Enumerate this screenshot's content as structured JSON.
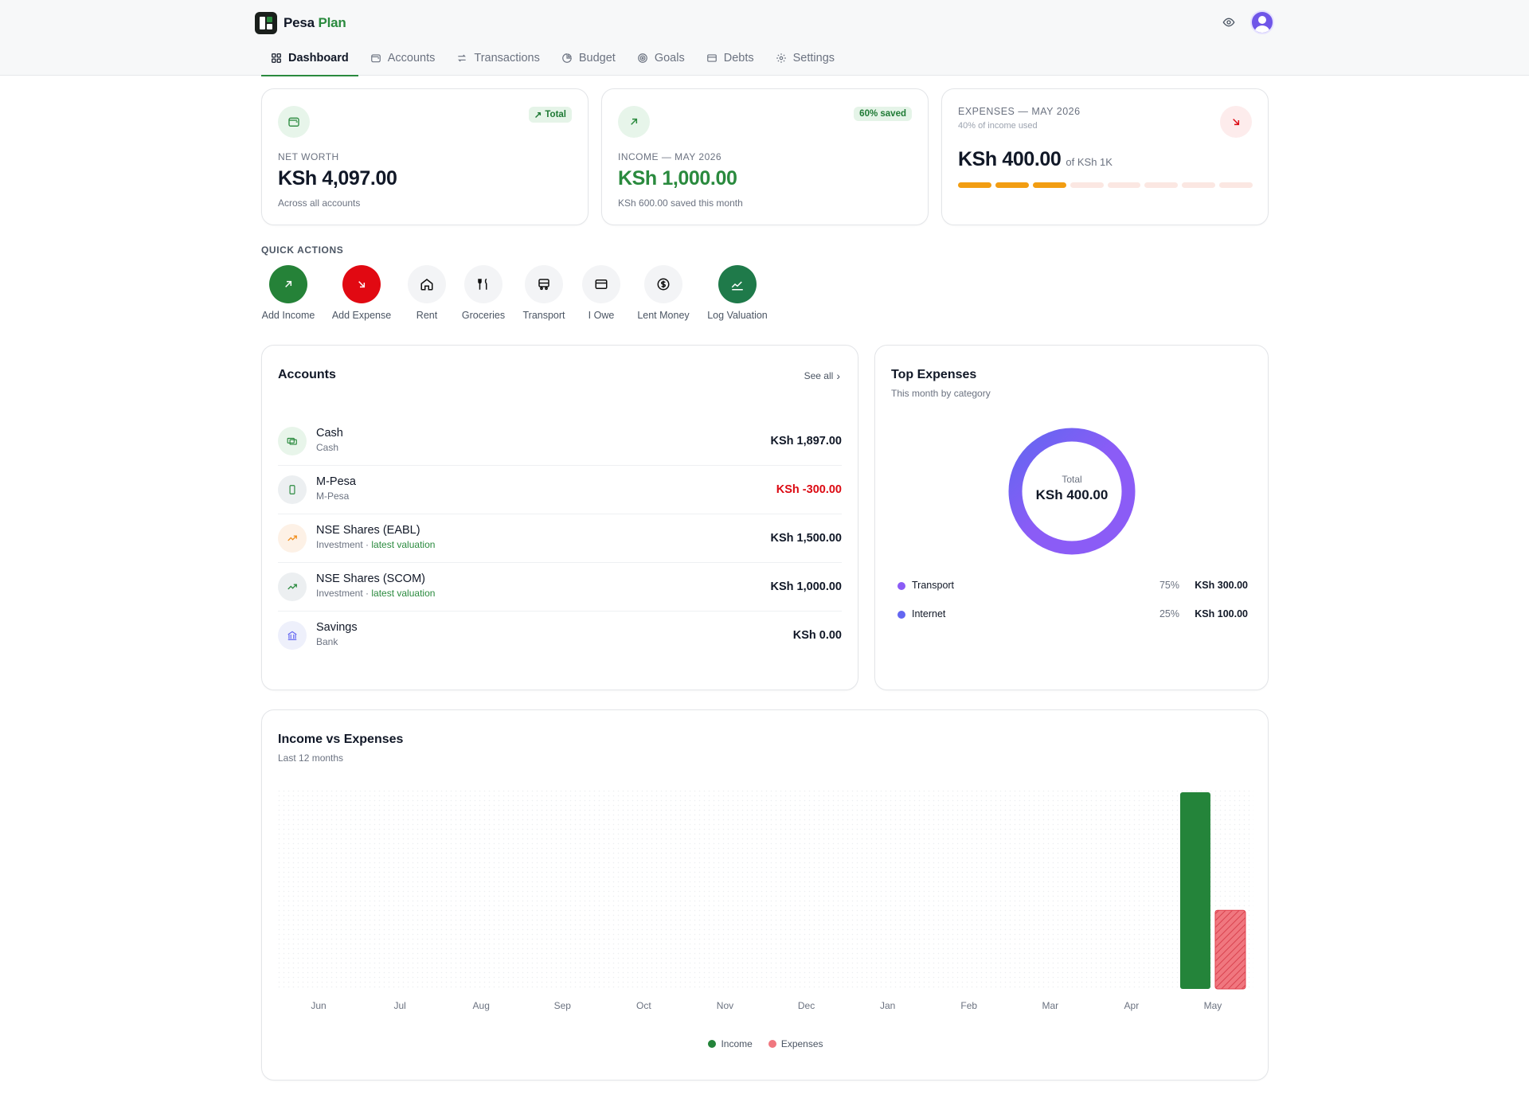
{
  "app": {
    "name_part1": "Pesa",
    "name_part2": "Plan"
  },
  "header": {
    "eye_icon": "eye-icon",
    "avatar_icon": "user-icon"
  },
  "nav": {
    "tabs": [
      {
        "label": "Dashboard",
        "icon": "grid-icon",
        "active": true
      },
      {
        "label": "Accounts",
        "icon": "wallet-icon"
      },
      {
        "label": "Transactions",
        "icon": "arrows-icon"
      },
      {
        "label": "Budget",
        "icon": "pie-icon"
      },
      {
        "label": "Goals",
        "icon": "target-icon"
      },
      {
        "label": "Debts",
        "icon": "card-icon"
      },
      {
        "label": "Settings",
        "icon": "gear-icon"
      }
    ]
  },
  "net_worth": {
    "tag": "Total",
    "label": "NET WORTH",
    "value": "KSh 4,097.00",
    "sub": "Across all accounts"
  },
  "income": {
    "tag": "60% saved",
    "label": "INCOME — MAY 2026",
    "value": "KSh 1,000.00",
    "sub": "KSh 600.00 saved this month"
  },
  "expenses": {
    "label": "EXPENSES — MAY 2026",
    "sub": "40% of income used",
    "value": "KSh 400.00",
    "of": "of KSh 1K",
    "progress_fraction": 0.4,
    "segments": 8
  },
  "quick_actions": {
    "title": "QUICK ACTIONS",
    "items": [
      {
        "label": "Add Income",
        "icon": "arrow-up-right-icon"
      },
      {
        "label": "Add Expense",
        "icon": "arrow-down-right-icon"
      },
      {
        "label": "Rent",
        "icon": "home-icon"
      },
      {
        "label": "Groceries",
        "icon": "utensils-icon"
      },
      {
        "label": "Transport",
        "icon": "bus-icon"
      },
      {
        "label": "I Owe",
        "icon": "card-icon"
      },
      {
        "label": "Lent Money",
        "icon": "dollar-icon"
      },
      {
        "label": "Log Valuation",
        "icon": "chart-line-icon"
      }
    ]
  },
  "accounts": {
    "title": "Accounts",
    "see_all": "See all",
    "rows": [
      {
        "name": "Cash",
        "type": "Cash",
        "note": "",
        "balance": "KSh 1,897.00",
        "negative": false,
        "icon": "cash-icon"
      },
      {
        "name": "M-Pesa",
        "type": "M-Pesa",
        "note": "",
        "balance": "KSh -300.00",
        "negative": true,
        "icon": "phone-icon"
      },
      {
        "name": "NSE Shares (EABL)",
        "type": "Investment · ",
        "note": "latest valuation",
        "balance": "KSh 1,500.00",
        "negative": false,
        "icon": "trend-up-icon"
      },
      {
        "name": "NSE Shares (SCOM)",
        "type": "Investment · ",
        "note": "latest valuation",
        "balance": "KSh 1,000.00",
        "negative": false,
        "icon": "trend-up-icon"
      },
      {
        "name": "Savings",
        "type": "Bank",
        "note": "",
        "balance": "KSh 0.00",
        "negative": false,
        "icon": "bank-icon"
      }
    ]
  },
  "top_expenses": {
    "title": "Top Expenses",
    "subtitle": "This month by category",
    "total_label": "Total",
    "total_value": "KSh 400.00",
    "items": [
      {
        "name": "Transport",
        "percent": "75%",
        "amount": "KSh 300.00",
        "color": "#8b5cf6"
      },
      {
        "name": "Internet",
        "percent": "25%",
        "amount": "KSh 100.00",
        "color": "#6366f1"
      }
    ]
  },
  "chart_data": {
    "type": "bar",
    "title": "Income vs Expenses",
    "subtitle": "Last 12 months",
    "categories": [
      "Jun",
      "Jul",
      "Aug",
      "Sep",
      "Oct",
      "Nov",
      "Dec",
      "Jan",
      "Feb",
      "Mar",
      "Apr",
      "May"
    ],
    "series": [
      {
        "name": "Income",
        "values": [
          0,
          0,
          0,
          0,
          0,
          0,
          0,
          0,
          0,
          0,
          0,
          1000
        ],
        "color": "#24843a"
      },
      {
        "name": "Expenses",
        "values": [
          0,
          0,
          0,
          0,
          0,
          0,
          0,
          0,
          0,
          0,
          0,
          400
        ],
        "color": "#f0777f"
      }
    ],
    "ylim": [
      0,
      1000
    ],
    "grid": false,
    "legend": "bottom"
  }
}
